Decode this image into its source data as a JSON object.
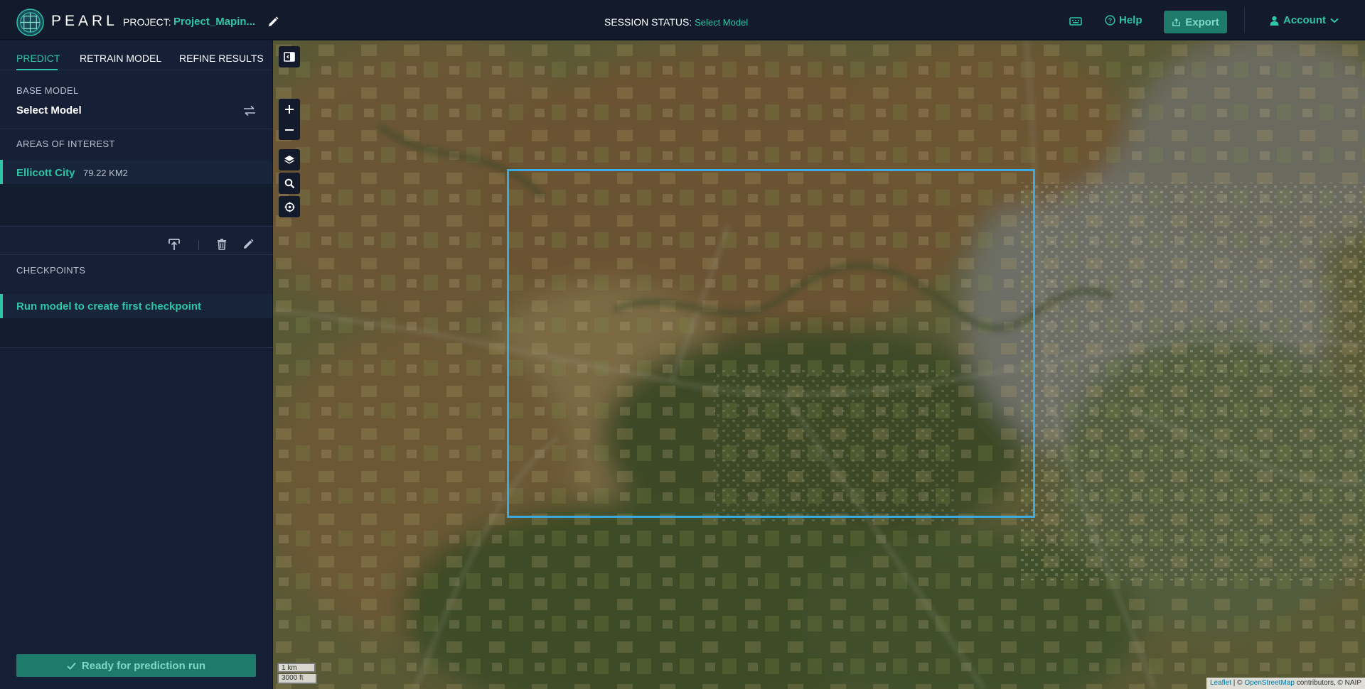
{
  "header": {
    "brand": "PEARL",
    "project_label": "PROJECT:",
    "project_name": "Project_Mapin...",
    "session_label": "SESSION STATUS:",
    "session_value": "Select Model",
    "help_label": "Help",
    "export_label": "Export",
    "account_label": "Account"
  },
  "sidebar": {
    "tabs": [
      {
        "label": "PREDICT",
        "active": true
      },
      {
        "label": "RETRAIN MODEL",
        "active": false
      },
      {
        "label": "REFINE RESULTS",
        "active": false
      }
    ],
    "base_model_label": "BASE MODEL",
    "base_model_value": "Select Model",
    "aoi_label": "AREAS OF INTEREST",
    "aois": [
      {
        "name": "Ellicott City",
        "area": "79.22 KM2"
      }
    ],
    "checkpoints_label": "CHECKPOINTS",
    "checkpoint_hint": "Run model to create first checkpoint",
    "run_button": "Ready for prediction run"
  },
  "map": {
    "scale_km": "1 km",
    "scale_ft": "3000 ft",
    "attribution_leaflet": "Leaflet",
    "attribution_sep": " | © ",
    "attribution_osm": "OpenStreetMap",
    "attribution_rest": " contributors, © NAIP"
  },
  "colors": {
    "accent": "#2ec4a6",
    "background": "#121a2b",
    "sidebar": "#152036",
    "aoi_outline": "#3ea9dd"
  }
}
